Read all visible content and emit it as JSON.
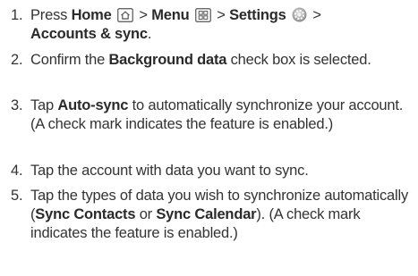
{
  "steps": [
    {
      "number": "1.",
      "parts": {
        "press": "Press ",
        "home": "Home",
        "gt1": " > ",
        "menu": "Menu",
        "gt2": " > ",
        "settings": "Settings",
        "gt3": " >",
        "accounts": "Accounts & sync",
        "end": "."
      }
    },
    {
      "number": "2.",
      "parts": {
        "a": "Confirm the ",
        "b": "Background data",
        "c": " check box is selected."
      }
    },
    {
      "number": "3.",
      "parts": {
        "a": "Tap ",
        "b": "Auto-sync",
        "c": " to automatically synchronize your account. (A check mark indicates the feature is enabled.)"
      }
    },
    {
      "number": "4.",
      "parts": {
        "a": "Tap the account with data you want to sync."
      }
    },
    {
      "number": "5.",
      "parts": {
        "a": "Tap the types of data you wish to synchronize automatically (",
        "b": "Sync Contacts",
        "c": " or ",
        "d": "Sync Calendar",
        "e": "). (A check mark indicates the feature is enabled.)"
      }
    }
  ],
  "icons": {
    "home": "home-key-icon",
    "menu": "menu-key-icon",
    "settings": "settings-gear-icon"
  }
}
